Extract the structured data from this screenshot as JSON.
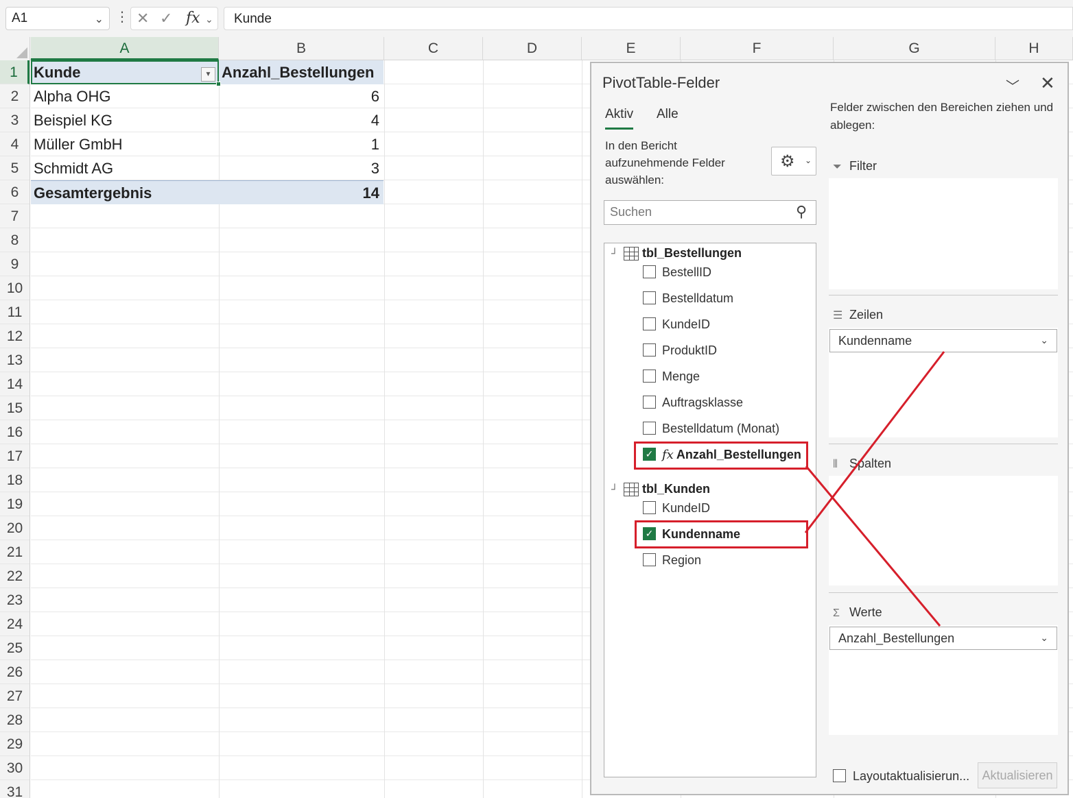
{
  "formula_bar": {
    "name_box": "A1",
    "name_box_chevron": "chevron-down-icon",
    "more_icon": "more-vertical-icon",
    "cancel_icon": "✕",
    "enter_icon": "✓",
    "fx_label": "fx",
    "formula_value": "Kunde"
  },
  "grid": {
    "columns": [
      "A",
      "B",
      "C",
      "D",
      "E",
      "F",
      "G",
      "H"
    ],
    "active_column": "A",
    "rows": [
      "1",
      "2",
      "3",
      "4",
      "5",
      "6",
      "7",
      "8",
      "9",
      "10",
      "11",
      "12",
      "13",
      "14",
      "15",
      "16",
      "17",
      "18",
      "19",
      "20",
      "21",
      "22",
      "23",
      "24",
      "25",
      "26",
      "27",
      "28",
      "29",
      "30",
      "31"
    ],
    "active_row": "1"
  },
  "pivot_table": {
    "header": {
      "row_label": "Kunde",
      "value_label": "Anzahl_Bestellungen"
    },
    "rows": [
      {
        "label": "Alpha OHG",
        "value": "6"
      },
      {
        "label": "Beispiel KG",
        "value": "4"
      },
      {
        "label": "Müller GmbH",
        "value": "1"
      },
      {
        "label": "Schmidt AG",
        "value": "3"
      }
    ],
    "total": {
      "label": "Gesamtergebnis",
      "value": "14"
    }
  },
  "pivot_pane": {
    "title": "PivotTable-Felder",
    "tabs": {
      "active": "Aktiv",
      "all": "Alle"
    },
    "instruction": "In den Bericht aufzunehmende Felder auswählen:",
    "search_placeholder": "Suchen",
    "tables": [
      {
        "name": "tbl_Bestellungen",
        "fields": [
          {
            "label": "BestellID",
            "checked": false
          },
          {
            "label": "Bestelldatum",
            "checked": false
          },
          {
            "label": "KundeID",
            "checked": false
          },
          {
            "label": "ProduktID",
            "checked": false
          },
          {
            "label": "Menge",
            "checked": false
          },
          {
            "label": "Auftragsklasse",
            "checked": false
          },
          {
            "label": "Bestelldatum (Monat)",
            "checked": false
          },
          {
            "label": "Anzahl_Bestellungen",
            "checked": true,
            "measure": true
          }
        ]
      },
      {
        "name": "tbl_Kunden",
        "fields": [
          {
            "label": "KundeID",
            "checked": false
          },
          {
            "label": "Kundenname",
            "checked": true
          },
          {
            "label": "Region",
            "checked": false
          }
        ]
      }
    ],
    "areas_hint": "Felder zwischen den Bereichen ziehen und ablegen:",
    "areas": {
      "filter": "Filter",
      "rows": "Zeilen",
      "columns": "Spalten",
      "values": "Werte",
      "rows_item": "Kundenname",
      "values_item": "Anzahl_Bestellungen"
    },
    "defer_layout_label": "Layoutaktualisierun...",
    "update_button": "Aktualisieren"
  },
  "annotation": {
    "color": "#d61f2b"
  }
}
